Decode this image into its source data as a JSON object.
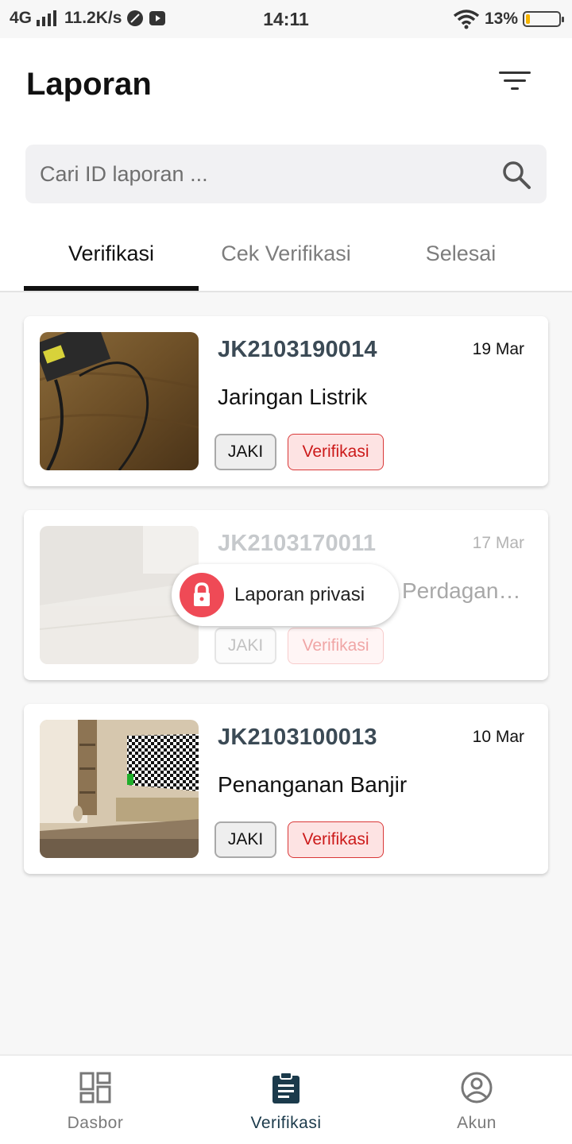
{
  "status_bar": {
    "network": "4G",
    "speed": "11.2K/s",
    "time": "14:11",
    "battery": "13%",
    "battery_level": 0.13
  },
  "header": {
    "title": "Laporan",
    "filter_icon": "filter-icon"
  },
  "search": {
    "placeholder": "Cari ID laporan ...",
    "icon": "search-icon"
  },
  "tabs": [
    {
      "label": "Verifikasi",
      "active": true
    },
    {
      "label": "Cek Verifikasi",
      "active": false
    },
    {
      "label": "Selesai",
      "active": false
    }
  ],
  "reports": [
    {
      "id": "JK2103190014",
      "date": "19 Mar",
      "category": "Jaringan Listrik",
      "source": "JAKI",
      "status": "Verifikasi",
      "private": false
    },
    {
      "id": "JK2103170011",
      "date": "17 Mar",
      "category": "Perdagangan",
      "source": "JAKI",
      "status": "Verifikasi",
      "private": true
    },
    {
      "id": "JK2103100013",
      "date": "10 Mar",
      "category": "Penanganan Banjir",
      "source": "JAKI",
      "status": "Verifikasi",
      "private": false
    }
  ],
  "privacy_badge": {
    "label": "Laporan privasi",
    "icon": "lock-icon",
    "color": "#ef4a56"
  },
  "colors": {
    "status_red": "#cc1a1a",
    "active_nav": "#1b3a4b",
    "privacy_red": "#ef4a56"
  },
  "bottom_nav": [
    {
      "label": "Dasbor",
      "icon": "dashboard-icon",
      "active": false
    },
    {
      "label": "Verifikasi",
      "icon": "clipboard-icon",
      "active": true
    },
    {
      "label": "Akun",
      "icon": "account-icon",
      "active": false
    }
  ]
}
